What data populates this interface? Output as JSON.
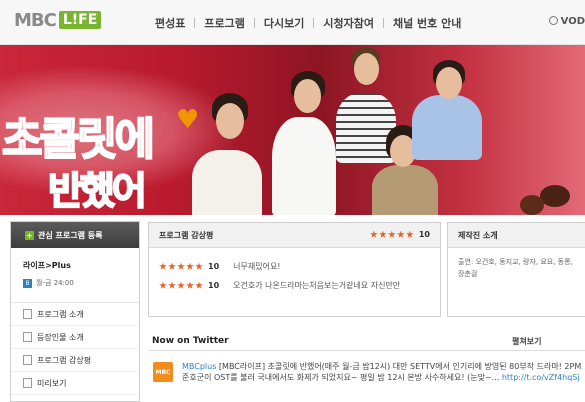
{
  "header": {
    "logo_left": "MBC",
    "logo_right": "L!FE",
    "nav": [
      "편성표",
      "프로그램",
      "다시보기",
      "시청자참여",
      "채널 번호 안내"
    ],
    "vod_label": "VOD"
  },
  "banner": {
    "title_line1": "초콜릿에",
    "title_line2": "반했어"
  },
  "left_panel": {
    "favorite_button": "관심 프로그램 등록",
    "program_name": "라이프>Plus",
    "schedule": "월-금 24:00",
    "menu": [
      "프로그램 소개",
      "등장인물 소개",
      "프로그램 감상평",
      "미리보기"
    ]
  },
  "reviews": {
    "title": "프로그램 감상평",
    "average_score": "10",
    "average_stars": 5,
    "items": [
      {
        "stars": 5,
        "score": "10",
        "text": "너무재밌어요!"
      },
      {
        "stars": 5,
        "score": "10",
        "text": "오건호가 나온드라마는처음보는거같네요 자신만만"
      }
    ]
  },
  "cast": {
    "title": "제작진 소개",
    "text": "출연: 오건호, 동지교, 랑자, 요요, 동롱, 장춘걸"
  },
  "twitter": {
    "title": "Now on Twitter",
    "more_label": "펼쳐보기",
    "avatar_text": "MBC",
    "user": "MBCplus",
    "text": "[MBC라이프] 초콜릿에 반했어(매주 월-금 밤12시) 대만 SETTV에서 인기리에 방영된 80부작 드라마! 2PM 준호군이 OST를 불러 국내에서도 화제가 되었지요~ 평일 밤 12시 본방 사수하세요! (눈맞~...",
    "link": "http://t.co/vZf4hqSj"
  },
  "colors": {
    "accent_green": "#7ab531",
    "star_orange": "#e1622b",
    "banner_red": "#c9273a",
    "link_blue": "#2d7fc6"
  }
}
